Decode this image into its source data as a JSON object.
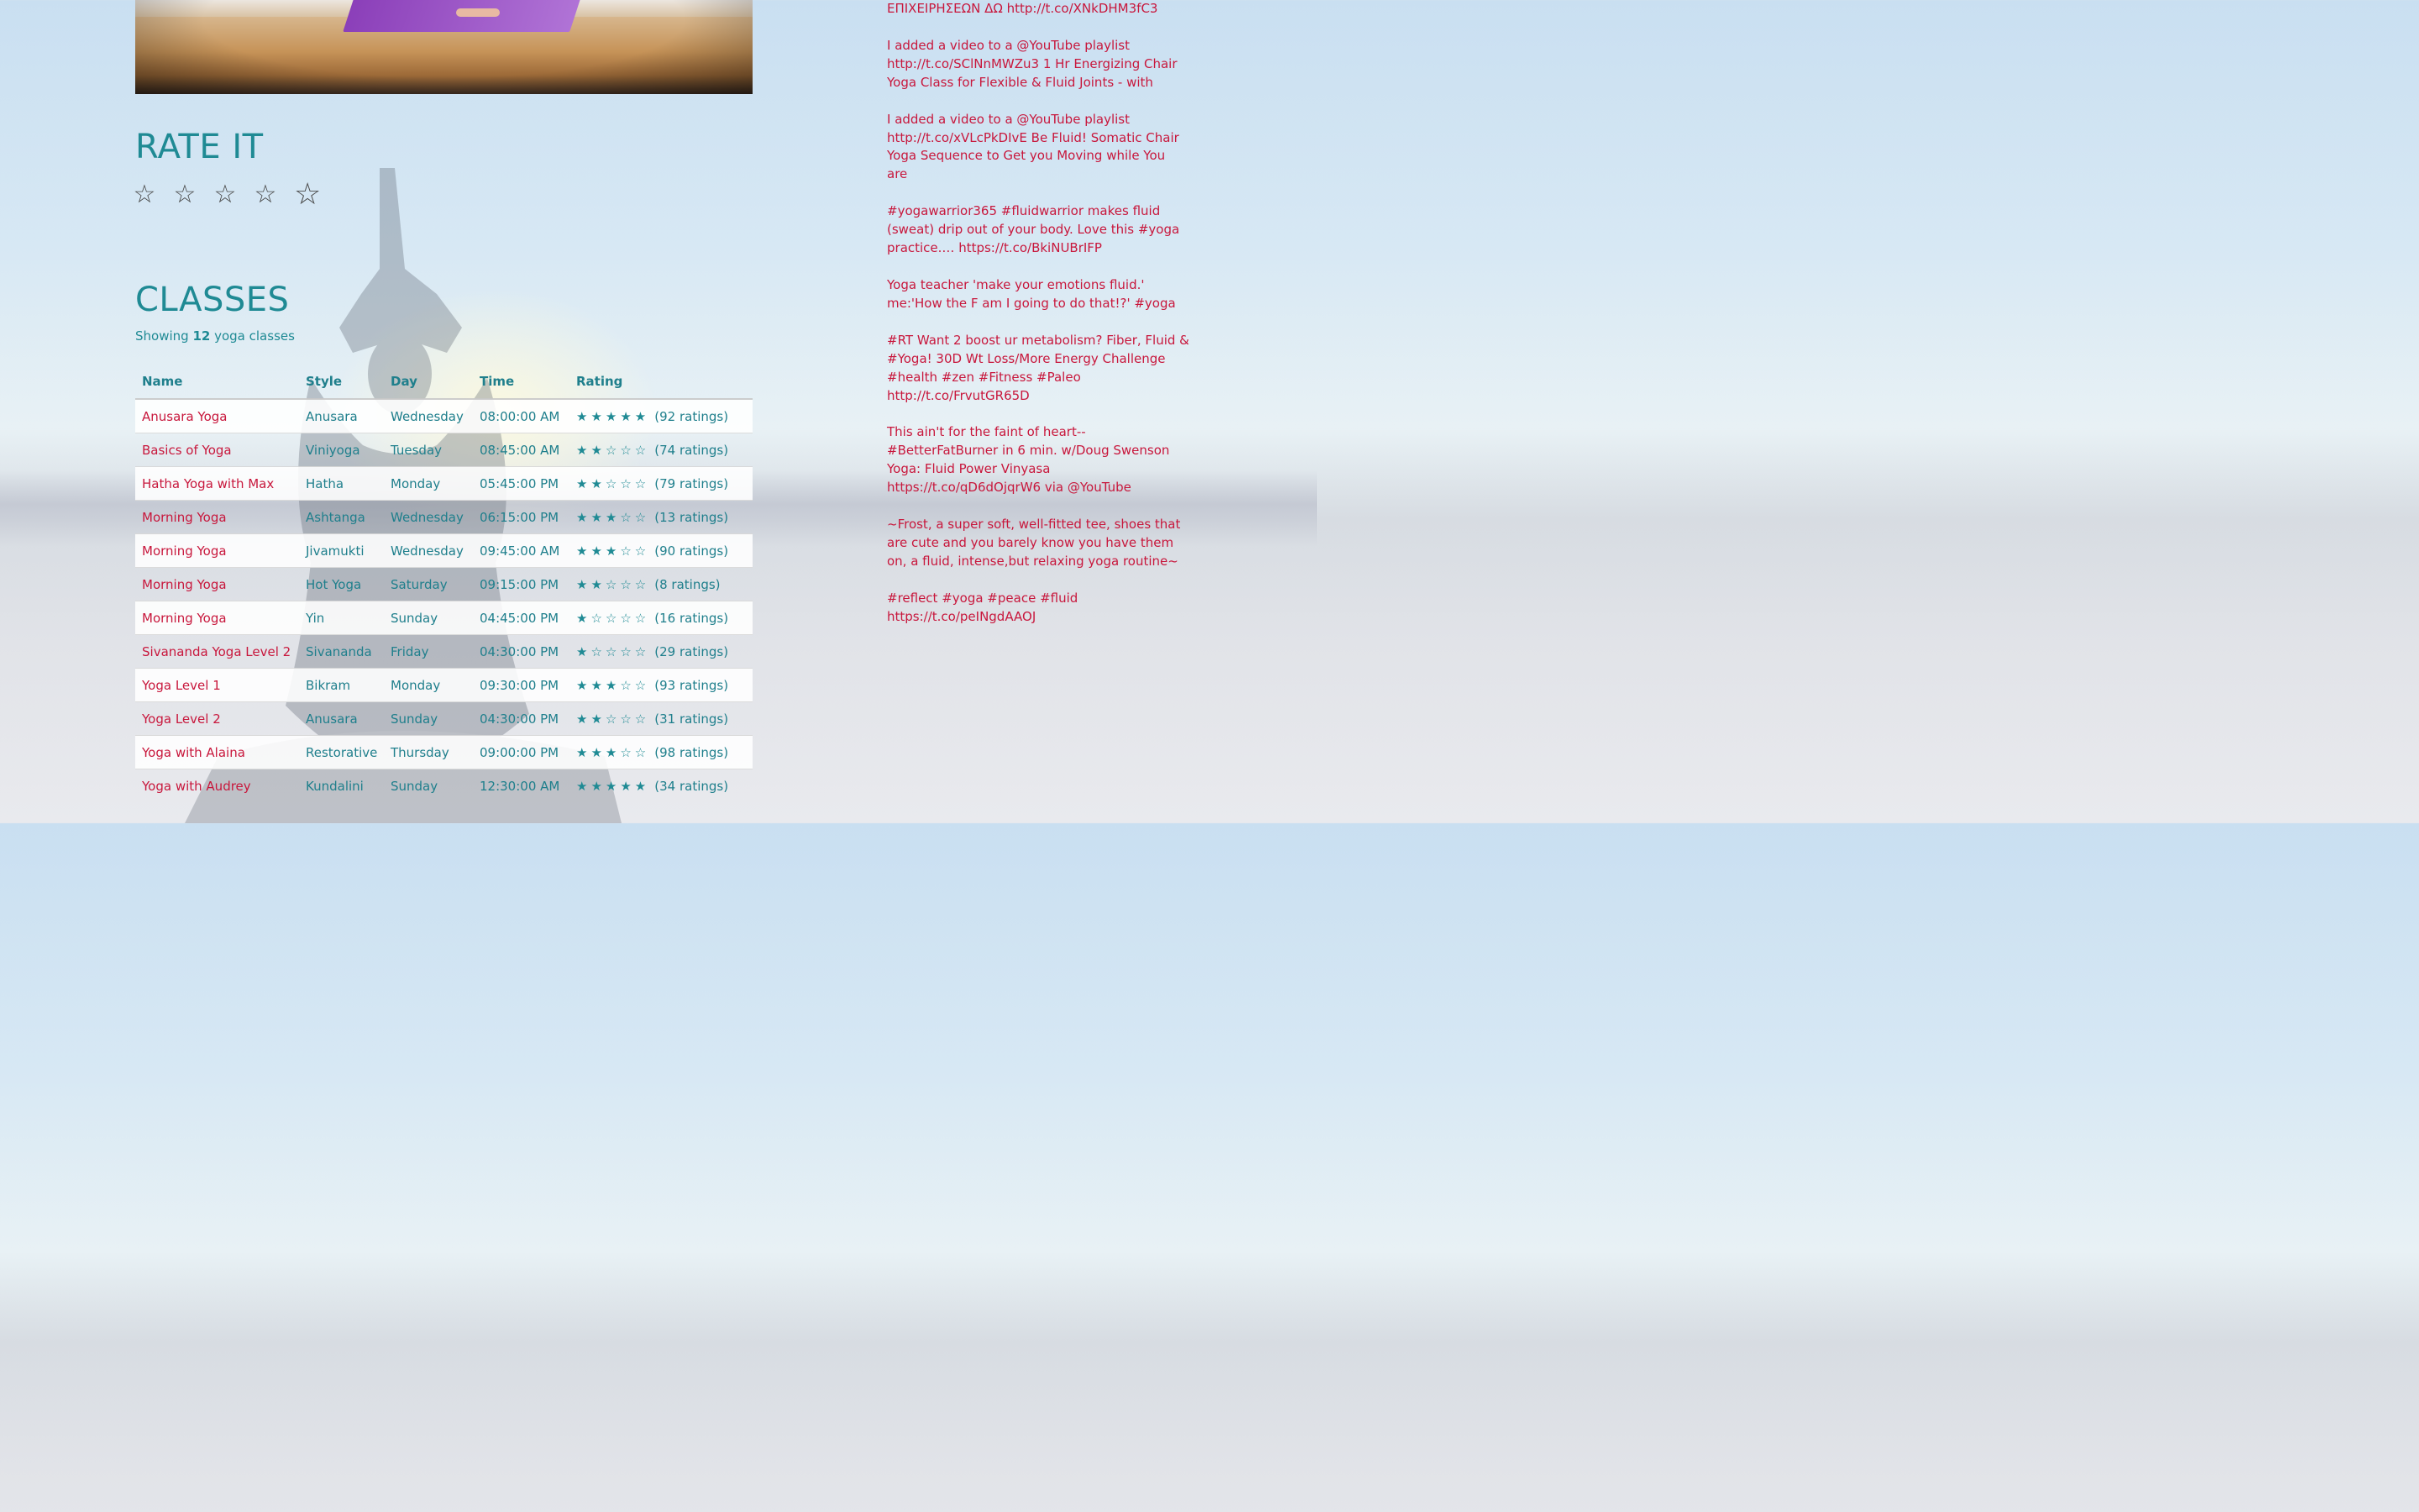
{
  "rate_section": {
    "title": "RATE IT",
    "stars": [
      "☆",
      "☆",
      "☆",
      "☆",
      "☆"
    ]
  },
  "classes_section": {
    "title": "CLASSES",
    "showing_prefix": "Showing",
    "showing_count": "12",
    "showing_suffix": "yoga classes",
    "columns": [
      "Name",
      "Style",
      "Day",
      "Time",
      "Rating"
    ],
    "rows": [
      {
        "name": "Anusara Yoga",
        "style": "Anusara",
        "day": "Wednesday",
        "time": "08:00:00 AM",
        "stars": "★★★★★",
        "rating": 5,
        "ratings": "(92 ratings)"
      },
      {
        "name": "Basics of Yoga",
        "style": "Viniyoga",
        "day": "Tuesday",
        "time": "08:45:00 AM",
        "stars": "★★☆☆☆",
        "rating": 2,
        "ratings": "(74 ratings)"
      },
      {
        "name": "Hatha Yoga with Max",
        "style": "Hatha",
        "day": "Monday",
        "time": "05:45:00 PM",
        "stars": "★★☆☆☆",
        "rating": 2,
        "ratings": "(79 ratings)"
      },
      {
        "name": "Morning Yoga",
        "style": "Ashtanga",
        "day": "Wednesday",
        "time": "06:15:00 PM",
        "stars": "★★★☆☆",
        "rating": 3,
        "ratings": "(13 ratings)"
      },
      {
        "name": "Morning Yoga",
        "style": "Jivamukti",
        "day": "Wednesday",
        "time": "09:45:00 AM",
        "stars": "★★★☆☆",
        "rating": 3,
        "ratings": "(90 ratings)"
      },
      {
        "name": "Morning Yoga",
        "style": "Hot Yoga",
        "day": "Saturday",
        "time": "09:15:00 PM",
        "stars": "★★☆☆☆",
        "rating": 2,
        "ratings": "(8 ratings)"
      },
      {
        "name": "Morning Yoga",
        "style": "Yin",
        "day": "Sunday",
        "time": "04:45:00 PM",
        "stars": "★☆☆☆☆",
        "rating": 1,
        "ratings": "(16 ratings)"
      },
      {
        "name": "Sivananda Yoga Level 2",
        "style": "Sivananda",
        "day": "Friday",
        "time": "04:30:00 PM",
        "stars": "★☆☆☆☆",
        "rating": 1,
        "ratings": "(29 ratings)"
      },
      {
        "name": "Yoga Level 1",
        "style": "Bikram",
        "day": "Monday",
        "time": "09:30:00 PM",
        "stars": "★★★☆☆",
        "rating": 3,
        "ratings": "(93 ratings)"
      },
      {
        "name": "Yoga Level 2",
        "style": "Anusara",
        "day": "Sunday",
        "time": "04:30:00 PM",
        "stars": "★★☆☆☆",
        "rating": 2,
        "ratings": "(31 ratings)"
      },
      {
        "name": "Yoga with Alaina",
        "style": "Restorative",
        "day": "Thursday",
        "time": "09:00:00 PM",
        "stars": "★★★☆☆",
        "rating": 3,
        "ratings": "(98 ratings)"
      },
      {
        "name": "Yoga with Audrey",
        "style": "Kundalini",
        "day": "Sunday",
        "time": "12:30:00 AM",
        "stars": "★★★★★",
        "rating": 5,
        "ratings": "(34 ratings)"
      }
    ]
  },
  "feed": {
    "tweets": [
      "ΕΠΙΧΕΙΡΗΣΕΩΝ ΔΩ http://t.co/XNkDHM3fC3",
      "I added a video to a @YouTube playlist http://t.co/SClNnMWZu3 1 Hr Energizing Chair Yoga Class for Flexible & Fluid Joints - with",
      "I added a video to a @YouTube playlist http://t.co/xVLcPkDIvE Be Fluid! Somatic Chair Yoga Sequence to Get you Moving while You are",
      "#yogawarrior365 #fluidwarrior makes fluid (sweat) drip out of your body. Love this #yoga practice.… https://t.co/BkiNUBrIFP",
      "Yoga teacher 'make your emotions fluid.' me:'How the F am I going to do that!?' #yoga",
      "#RT Want 2 boost ur metabolism? Fiber, Fluid & #Yoga! 30D Wt Loss/More Energy Challenge #health #zen #Fitness #Paleo http://t.co/FrvutGR65D",
      "This ain't for the faint of heart--#BetterFatBurner in 6 min. w/Doug Swenson Yoga: Fluid Power Vinyasa https://t.co/qD6dOjqrW6 via @YouTube",
      "~Frost, a super soft, well-fitted tee, shoes that are cute and you barely know you have them on, a fluid, intense,but relaxing yoga routine~",
      "#reflect #yoga #peace #fluid https://t.co/peINgdAAOJ"
    ]
  },
  "colors": {
    "teal": "#1f8a94",
    "crimson": "#c8173c",
    "star_outline": "#4a4a4a"
  }
}
